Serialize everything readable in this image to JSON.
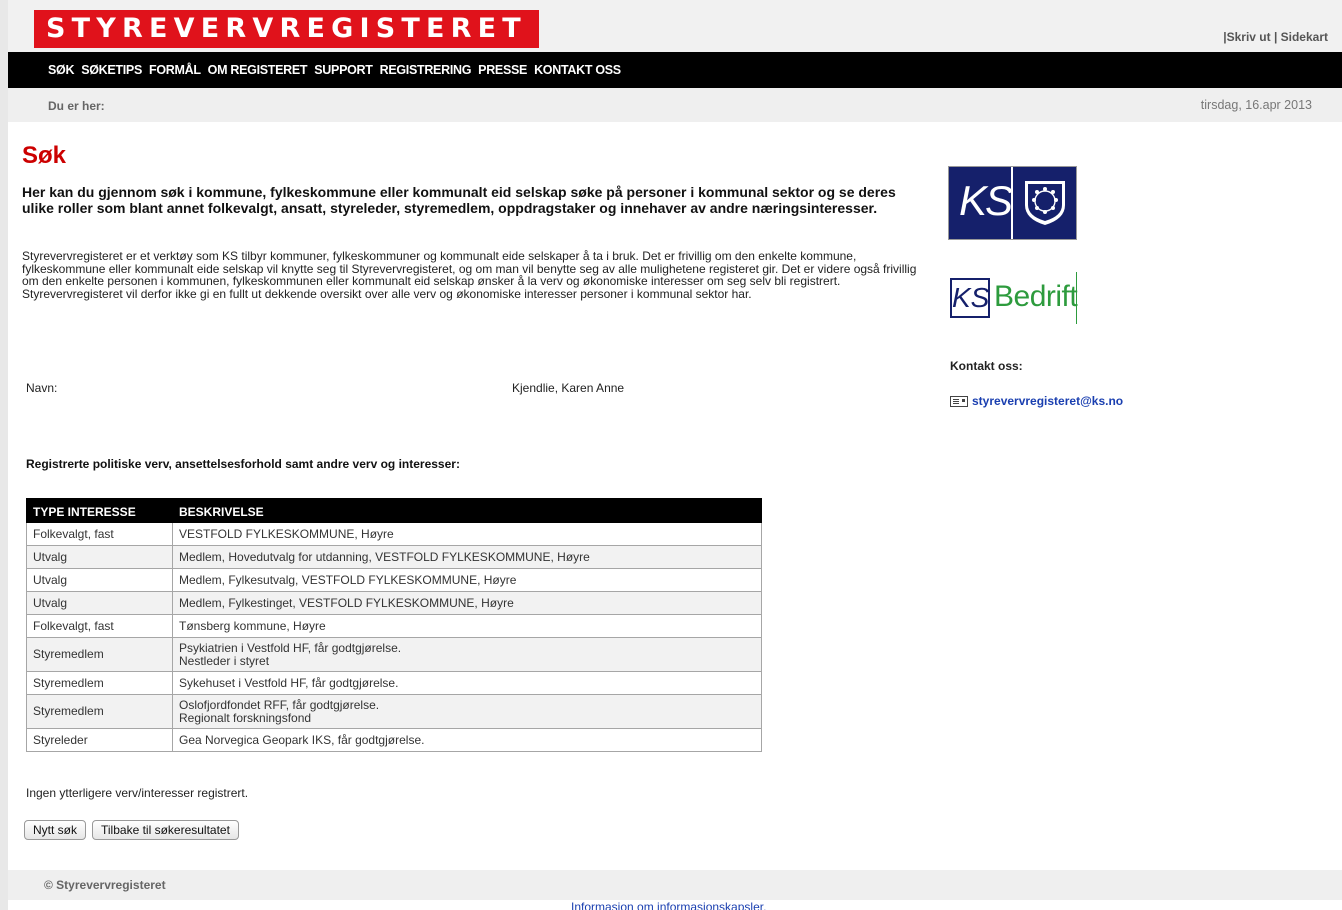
{
  "header": {
    "logo_text": "STYREVERVREGISTERET",
    "toplinks": {
      "sep1": "|",
      "print": "Skriv ut",
      "sep2": " | ",
      "sitemap": "Sidekart"
    }
  },
  "nav": {
    "items": [
      "SØK",
      "SØKETIPS",
      "FORMÅL",
      "OM REGISTERET",
      "SUPPORT",
      "REGISTRERING",
      "PRESSE",
      "KONTAKT OSS"
    ]
  },
  "breadcrumb": {
    "label": "Du er her:",
    "date": "tirsdag, 16.apr 2013"
  },
  "main": {
    "title": "Søk",
    "lead": "Her kan du gjennom søk i kommune, fylkeskommune eller kommunalt eid selskap søke på personer i kommunal sektor og se deres ulike roller som blant annet folkevalgt, ansatt, styreleder, styremedlem, oppdragstaker og innehaver av andre næringsinteresser.",
    "intro": "Styrevervregisteret er et verktøy som KS tilbyr kommuner, fylkeskommuner og kommunalt eide selskaper å ta i bruk. Det er frivillig om den enkelte kommune, fylkeskommune eller kommunalt eide selskap vil knytte seg til Styrevervregisteret, og om man vil benytte seg av alle mulighetene registeret gir. Det er videre også frivillig om den enkelte personen i kommunen, fylkeskommunen eller kommunalt eid selskap ønsker å la verv og økonomiske interesser om seg selv bli registrert. Styrevervregisteret vil derfor ikke gi en fullt ut dekkende oversikt over alle verv og økonomiske interesser personer i kommunal sektor har.",
    "navn_label": "Navn:",
    "navn_value": "Kjendlie, Karen Anne",
    "section_heading": "Registrerte politiske verv, ansettelsesforhold samt andre verv og interesser:",
    "table": {
      "headers": [
        "TYPE INTERESSE",
        "BESKRIVELSE"
      ],
      "rows": [
        {
          "type": "Folkevalgt, fast",
          "desc1": "VESTFOLD FYLKESKOMMUNE, Høyre",
          "desc2": ""
        },
        {
          "type": "Utvalg",
          "desc1": "Medlem, Hovedutvalg for utdanning, VESTFOLD FYLKESKOMMUNE, Høyre",
          "desc2": ""
        },
        {
          "type": "Utvalg",
          "desc1": "Medlem, Fylkesutvalg, VESTFOLD FYLKESKOMMUNE, Høyre",
          "desc2": ""
        },
        {
          "type": "Utvalg",
          "desc1": "Medlem, Fylkestinget, VESTFOLD FYLKESKOMMUNE, Høyre",
          "desc2": ""
        },
        {
          "type": "Folkevalgt, fast",
          "desc1": "Tønsberg kommune, Høyre",
          "desc2": ""
        },
        {
          "type": "Styremedlem",
          "desc1": "Psykiatrien i Vestfold HF, får godtgjørelse.",
          "desc2": "Nestleder i styret"
        },
        {
          "type": "Styremedlem",
          "desc1": "Sykehuset i Vestfold HF, får godtgjørelse.",
          "desc2": ""
        },
        {
          "type": "Styremedlem",
          "desc1": "Oslofjordfondet RFF, får godtgjørelse.",
          "desc2": "Regionalt forskningsfond"
        },
        {
          "type": "Styreleder",
          "desc1": "Gea Norvegica Geopark IKS, får godtgjørelse.",
          "desc2": ""
        }
      ]
    },
    "no_more": "Ingen ytterligere verv/interesser registrert.",
    "buttons": {
      "new_search": "Nytt søk",
      "back": "Tilbake til søkeresultatet"
    }
  },
  "sidebar": {
    "ks_logo_text": "KS",
    "ksb_logo_ks": "KS",
    "ksb_logo_text": "Bedrift",
    "contact_heading": "Kontakt oss:",
    "contact_email": "styrevervregisteret@ks.no"
  },
  "footer": {
    "copyright": "© Styrevervregisteret",
    "info_link": "Informasjon om informasjonskapsler."
  },
  "colors": {
    "brand_red": "#e0121b",
    "title_red": "#cc0000",
    "ks_blue": "#15206b",
    "ks_green": "#2d9b3d",
    "link_blue": "#1a3fb0"
  }
}
